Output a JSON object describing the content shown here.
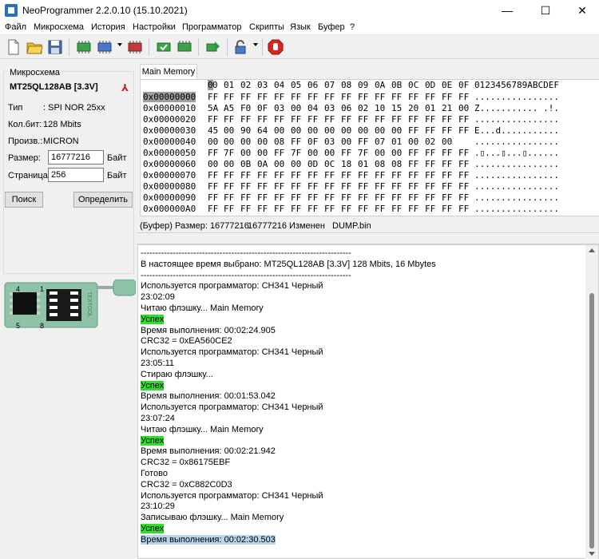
{
  "window": {
    "title": "NeoProgrammer 2.2.0.10 (15.10.2021)",
    "min_glyph": "—",
    "max_glyph": "☐",
    "close_glyph": "✕"
  },
  "menu": [
    "Файл",
    "Микросхема",
    "История",
    "Настройки",
    "Программатор",
    "Скрипты",
    "Язык",
    "Буфер",
    "?"
  ],
  "toolbar": {
    "icons": [
      "new-icon",
      "open-folder-icon",
      "save-icon",
      "read-chip-icon",
      "write-chip-icon",
      "dropdown",
      "erase-chip-icon",
      "verify-chip-icon",
      "blank-check-icon",
      "chip-arrow-icon",
      "lock-icon",
      "dropdown",
      "stop-icon"
    ]
  },
  "chip_panel": {
    "group_title": "Микросхема",
    "chip_name": "MT25QL128AB [3.3V]",
    "type_label": "Тип",
    "type_value": ": SPI NOR 25xx",
    "bits_label": "Кол.бит:",
    "bits_value": "128 Mbits",
    "maker_label": "Произв.:",
    "maker_value": "MICRON",
    "size_label": "Размер:",
    "size_value": "16777216",
    "size_unit": "Байт",
    "page_label": "Страница:",
    "page_value": "256",
    "page_unit": "Байт",
    "search_button": "Поиск",
    "detect_button": "Определить",
    "adapter_text": "TEXTOOL",
    "pin_labels": [
      "4",
      "1",
      "5",
      "8"
    ]
  },
  "tab": {
    "label": "Main Memory"
  },
  "hex": {
    "header_cells": [
      "0",
      "01",
      "02",
      "03",
      "04",
      "05",
      "06",
      "07",
      "08",
      "09",
      "0A",
      "0B",
      "0C",
      "0D",
      "0E",
      "0F"
    ],
    "header_first_digit": "0",
    "ascii_header": "0123456789ABCDEF",
    "rows": [
      {
        "addr": "0x00000000",
        "cells": [
          "FF",
          "FF",
          "FF",
          "FF",
          "FF",
          "FF",
          "FF",
          "FF",
          "FF",
          "FF",
          "FF",
          "FF",
          "FF",
          "FF",
          "FF",
          "FF"
        ],
        "ascii": "................"
      },
      {
        "addr": "0x00000010",
        "cells": [
          "5A",
          "A5",
          "F0",
          "0F",
          "03",
          "00",
          "04",
          "03",
          "06",
          "02",
          "10",
          "15",
          "20",
          "01",
          "21",
          "00"
        ],
        "ascii": "Z........... .!."
      },
      {
        "addr": "0x00000020",
        "cells": [
          "FF",
          "FF",
          "FF",
          "FF",
          "FF",
          "FF",
          "FF",
          "FF",
          "FF",
          "FF",
          "FF",
          "FF",
          "FF",
          "FF",
          "FF",
          "FF"
        ],
        "ascii": "................"
      },
      {
        "addr": "0x00000030",
        "cells": [
          "45",
          "00",
          "90",
          "64",
          "00",
          "00",
          "00",
          "00",
          "00",
          "00",
          "00",
          "00",
          "FF",
          "FF",
          "FF",
          "FF"
        ],
        "ascii": "E...d..........."
      },
      {
        "addr": "0x00000040",
        "cells": [
          "00",
          "00",
          "00",
          "00",
          "08",
          "FF",
          "0F",
          "03",
          "00",
          "FF",
          "07",
          "01",
          "00",
          "02",
          "00",
          "  "
        ],
        "ascii": "................"
      },
      {
        "addr": "0x00000050",
        "cells": [
          "FF",
          "7F",
          "00",
          "00",
          "FF",
          "7F",
          "00",
          "00",
          "FF",
          "7F",
          "00",
          "00",
          "FF",
          "FF",
          "FF",
          "FF"
        ],
        "ascii": ".▯...▯...▯......"
      },
      {
        "addr": "0x00000060",
        "cells": [
          "00",
          "00",
          "0B",
          "0A",
          "00",
          "00",
          "0D",
          "0C",
          "18",
          "01",
          "08",
          "08",
          "FF",
          "FF",
          "FF",
          "FF"
        ],
        "ascii": "................"
      },
      {
        "addr": "0x00000070",
        "cells": [
          "FF",
          "FF",
          "FF",
          "FF",
          "FF",
          "FF",
          "FF",
          "FF",
          "FF",
          "FF",
          "FF",
          "FF",
          "FF",
          "FF",
          "FF",
          "FF"
        ],
        "ascii": "................"
      },
      {
        "addr": "0x00000080",
        "cells": [
          "FF",
          "FF",
          "FF",
          "FF",
          "FF",
          "FF",
          "FF",
          "FF",
          "FF",
          "FF",
          "FF",
          "FF",
          "FF",
          "FF",
          "FF",
          "FF"
        ],
        "ascii": "................"
      },
      {
        "addr": "0x00000090",
        "cells": [
          "FF",
          "FF",
          "FF",
          "FF",
          "FF",
          "FF",
          "FF",
          "FF",
          "FF",
          "FF",
          "FF",
          "FF",
          "FF",
          "FF",
          "FF",
          "FF"
        ],
        "ascii": "................"
      },
      {
        "addr": "0x000000A0",
        "cells": [
          "FF",
          "FF",
          "FF",
          "FF",
          "FF",
          "FF",
          "FF",
          "FF",
          "FF",
          "FF",
          "FF",
          "FF",
          "FF",
          "FF",
          "FF",
          "FF"
        ],
        "ascii": "................"
      }
    ]
  },
  "status": {
    "buffer_size": "(Буфер) Размер: 16777216",
    "changed": "16777216 Изменен",
    "file": "DUMP.bin"
  },
  "log": [
    {
      "text": "------------------------------------------------------------------------",
      "style": ""
    },
    {
      "text": "В настоящее время выбрано:  MT25QL128AB [3.3V] 128 Mbits, 16 Mbytes",
      "style": ""
    },
    {
      "text": "------------------------------------------------------------------------",
      "style": ""
    },
    {
      "text": "Используется программатор: CH341 Черный",
      "style": ""
    },
    {
      "text": "23:02:09",
      "style": ""
    },
    {
      "text": "Читаю флэшку... Main Memory",
      "style": ""
    },
    {
      "text": "Успех",
      "style": "ok"
    },
    {
      "text": "Время выполнения: 00:02:24.905",
      "style": ""
    },
    {
      "text": "CRC32 = 0xEA560CE2",
      "style": ""
    },
    {
      "text": "Используется программатор: CH341 Черный",
      "style": ""
    },
    {
      "text": "23:05:11",
      "style": ""
    },
    {
      "text": "Стираю флэшку...",
      "style": ""
    },
    {
      "text": "Успех",
      "style": "ok"
    },
    {
      "text": "Время выполнения: 00:01:53.042",
      "style": ""
    },
    {
      "text": "Используется программатор: CH341 Черный",
      "style": ""
    },
    {
      "text": "23:07:24",
      "style": ""
    },
    {
      "text": "Читаю флэшку... Main Memory",
      "style": ""
    },
    {
      "text": "Успех",
      "style": "ok"
    },
    {
      "text": "Время выполнения: 00:02:21.942",
      "style": ""
    },
    {
      "text": "CRC32 = 0x86175EBF",
      "style": ""
    },
    {
      "text": "Готово",
      "style": ""
    },
    {
      "text": "CRC32 = 0xC882C0D3",
      "style": ""
    },
    {
      "text": "Используется программатор: CH341 Черный",
      "style": ""
    },
    {
      "text": "23:10:29",
      "style": ""
    },
    {
      "text": "Записываю флэшку... Main Memory",
      "style": ""
    },
    {
      "text": "Успех",
      "style": "ok"
    },
    {
      "text": "Время выполнения: 00:02:30.503",
      "style": "sel"
    }
  ],
  "colors": {
    "success": "#2fdd2f",
    "selection": "#b7d4ea",
    "address_highlight": "#9e9e9e",
    "adapter_green": "#8fc3a8"
  }
}
